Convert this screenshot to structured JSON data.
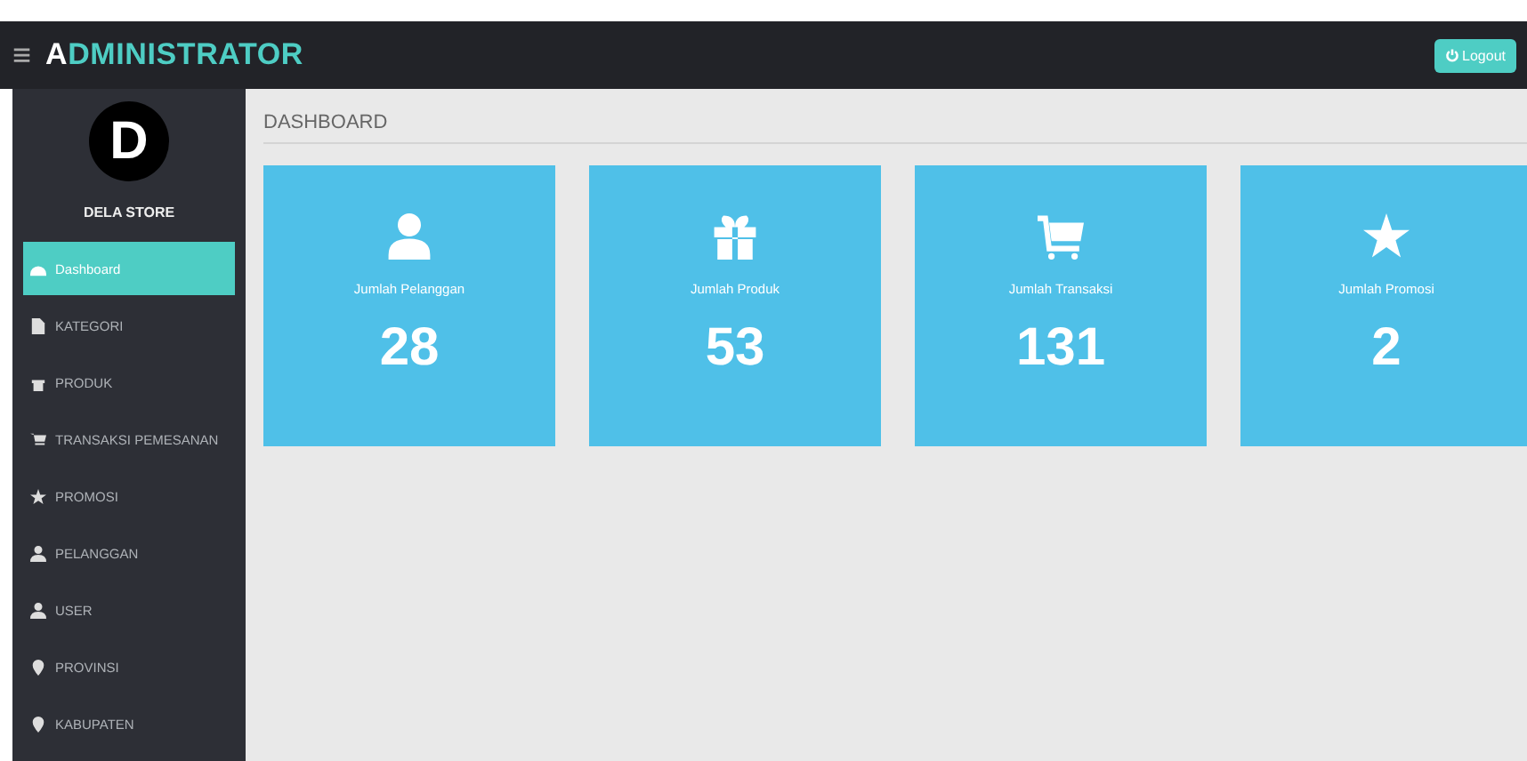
{
  "header": {
    "menu_glyph": "≡",
    "title_initial": "A",
    "title_rest": "DMINISTRATOR",
    "logout": "Logout"
  },
  "sidebar": {
    "avatar_letter": "D",
    "store_name": "DELA STORE",
    "items": [
      {
        "label": "Dashboard",
        "selected": true
      },
      {
        "label": "KATEGORI",
        "selected": false
      },
      {
        "label": "PRODUK",
        "selected": false
      },
      {
        "label": "TRANSAKSI PEMESANAN",
        "selected": false
      },
      {
        "label": "PROMOSI",
        "selected": false
      },
      {
        "label": "PELANGGAN",
        "selected": false
      },
      {
        "label": "USER",
        "selected": false
      },
      {
        "label": "PROVINSI",
        "selected": false
      },
      {
        "label": "KABUPATEN",
        "selected": false
      }
    ]
  },
  "page_title": "DASHBOARD",
  "cards": [
    {
      "label": "Jumlah Pelanggan",
      "value": "28"
    },
    {
      "label": "Jumlah Produk",
      "value": "53"
    },
    {
      "label": "Jumlah Transaksi",
      "value": "131"
    },
    {
      "label": "Jumlah Promosi",
      "value": "2"
    }
  ]
}
